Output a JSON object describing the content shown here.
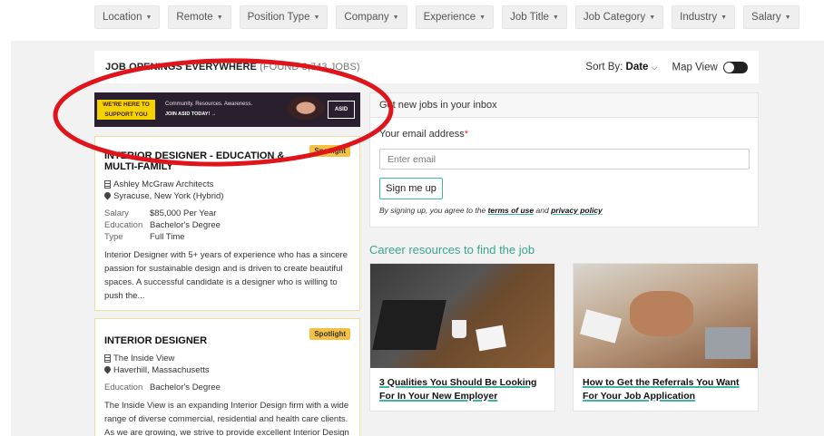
{
  "filters": [
    {
      "label": "Location"
    },
    {
      "label": "Remote"
    },
    {
      "label": "Position Type"
    },
    {
      "label": "Company"
    },
    {
      "label": "Experience"
    },
    {
      "label": "Job Title"
    },
    {
      "label": "Job Category"
    },
    {
      "label": "Industry"
    },
    {
      "label": "Salary"
    }
  ],
  "results": {
    "title": "JOB OPENINGS EVERYWHERE",
    "count": "(FOUND 3,743 JOBS)",
    "sort_label": "Sort By:",
    "sort_value": "Date",
    "map_view_label": "Map View"
  },
  "banner": {
    "tag_line1": "WE'RE HERE TO",
    "tag_line2": "SUPPORT YOU",
    "tagline": "Community. Resources. Awareness.",
    "cta": "JOIN ASID TODAY!  →",
    "logo": "ASID"
  },
  "jobs": [
    {
      "badge": "Spotlight",
      "title": "INTERIOR DESIGNER - EDUCATION & MULTI-FAMILY",
      "company": "Ashley McGraw Architects",
      "location": "Syracuse, New York (Hybrid)",
      "salary_label": "Salary",
      "salary": "$85,000 Per Year",
      "education_label": "Education",
      "education": "Bachelor's Degree",
      "type_label": "Type",
      "type": "Full Time",
      "description": "Interior Designer with 5+ years of experience who has a sincere passion for sustainable design and is driven to create beautiful spaces. A successful candidate is a designer who is willing to push the..."
    },
    {
      "badge": "Spotlight",
      "title": "INTERIOR DESIGNER",
      "company": "The Inside View",
      "location": "Haverhill, Massachusetts",
      "education_label": "Education",
      "education": "Bachelor's Degree",
      "description": "The Inside View is an expanding Interior Design firm with a wide range of diverse commercial, residential and health care clients. As we are growing, we strive to provide excellent Interior Design"
    }
  ],
  "signup": {
    "header": "Get new jobs in your inbox",
    "email_label": "Your email address",
    "required_mark": "*",
    "email_placeholder": "Enter email",
    "button": "Sign me up",
    "terms_prefix": "By signing up, you agree to the",
    "terms_link": "terms of use",
    "terms_and": "and",
    "privacy_link": "privacy policy"
  },
  "career": {
    "heading": "Career resources to find the job",
    "articles": [
      {
        "title": "3 Qualities You Should Be Looking For In Your New Employer"
      },
      {
        "title": "How to Get the Referrals You Want For Your Job Application"
      }
    ]
  },
  "colors": {
    "accent_teal": "#3fb6a2",
    "spotlight_yellow": "#f6c142",
    "annotation_red": "#e0141b"
  }
}
